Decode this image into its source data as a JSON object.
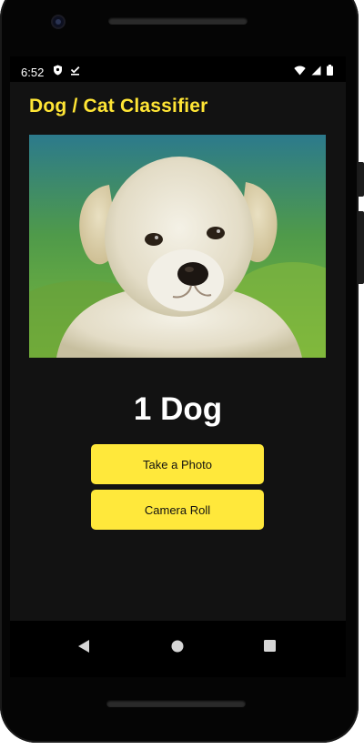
{
  "status_bar": {
    "time": "6:52",
    "left_icons": [
      "shield-icon",
      "download-done-icon"
    ],
    "right_icons": [
      "wifi-icon",
      "cell-signal-icon",
      "battery-icon"
    ]
  },
  "app": {
    "title": "Dog / Cat Classifier",
    "title_color": "#ffe535",
    "background": "#121212",
    "image": {
      "subject": "dog",
      "icon": "puppy-photo"
    },
    "result": "1 Dog",
    "buttons": {
      "take_photo": "Take a Photo",
      "camera_roll": "Camera Roll"
    },
    "button_color": "#ffe83b"
  },
  "nav_bar": {
    "icons": [
      "back-icon",
      "home-icon",
      "recents-icon"
    ]
  }
}
